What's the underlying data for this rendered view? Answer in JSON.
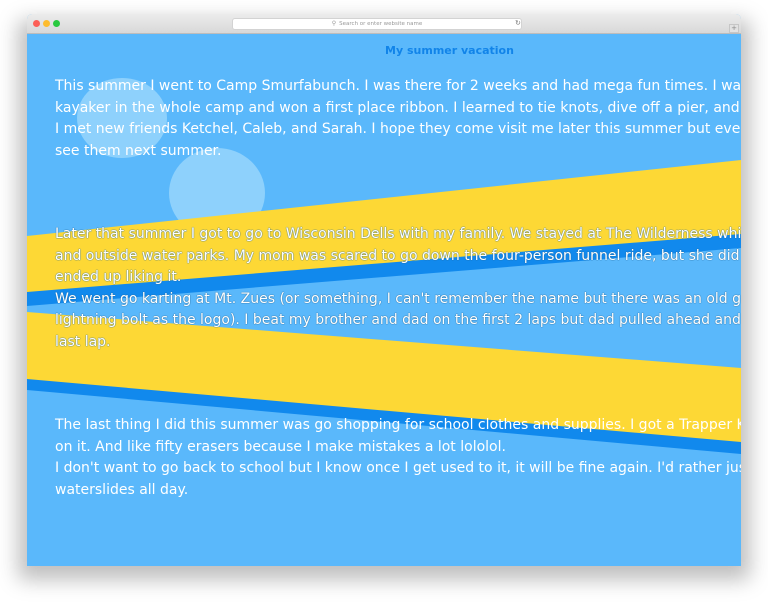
{
  "browser": {
    "url_placeholder": "Search or enter website name",
    "search_icon": "search-icon",
    "reload_icon": "reload-icon",
    "reload_glyph": "↻",
    "new_tab_glyph": "+"
  },
  "page": {
    "title": "My summer vacation",
    "colors": {
      "background": "#5ab8fb",
      "band_yellow": "#fdd835",
      "band_blue": "#1189ed",
      "cloud": "#8ed1fc",
      "title": "#1184e9",
      "text": "#ffffff"
    },
    "paragraphs": [
      {
        "lines": [
          "This summer I went to Camp Smurfabunch. I was there for 2 weeks and had mega fun times. I was the",
          "kayaker in the whole camp and won a first place ribbon. I learned to tie knots, dive off a pier, and lick",
          "I met new friends Ketchel, Caleb, and Sarah. I hope they come visit me later this summer but even if th",
          "see them next summer."
        ]
      },
      {
        "lines": [
          "Later that summer I got to go to Wisconsin Dells with my family. We stayed at The Wilderness which h",
          "and outside water parks. My mom was scared to go down the four-person funnel ride, but she did any",
          "ended up liking it.",
          "We went go karting at Mt. Zues (or something, I can't remember the name but there was an old god d",
          "lightning bolt as the logo). I beat my brother and dad on the first 2 laps but dad pulled ahead and bea",
          "last lap."
        ]
      },
      {
        "lines": [
          "The last thing I did this summer was go shopping for school clothes and supplies. I got a Trapper Keep",
          "on it. And like fifty erasers because I make mistakes a lot lololol.",
          "I don't want to go back to school but I know once I get used to it, it will be fine again. I'd rather just go",
          "waterslides all day."
        ]
      }
    ]
  }
}
